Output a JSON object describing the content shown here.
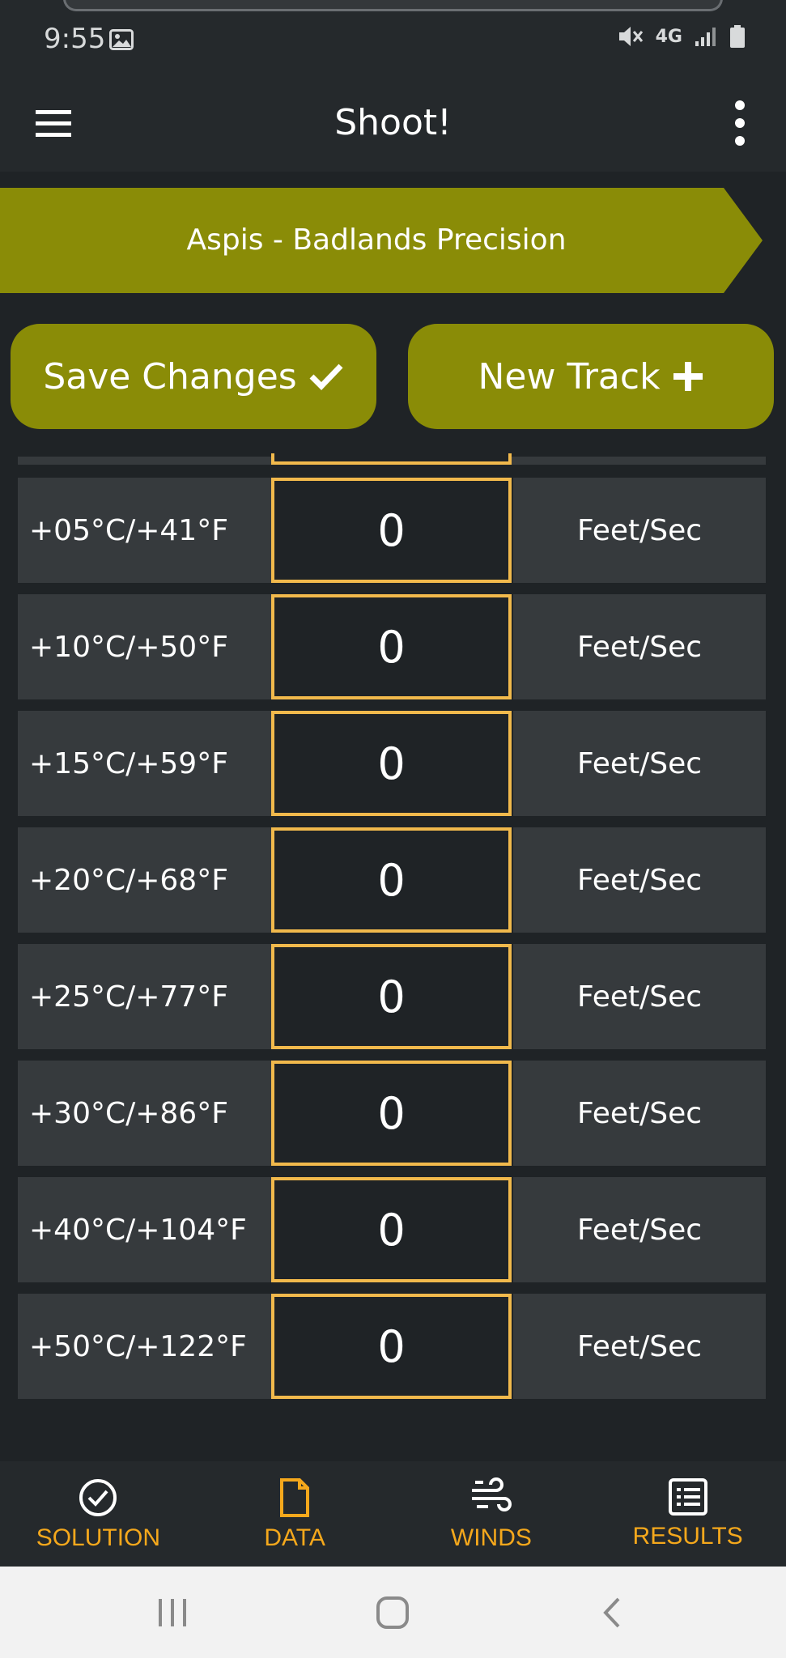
{
  "status": {
    "time": "9:55",
    "network": "4G"
  },
  "app": {
    "title": "Shoot!"
  },
  "track": {
    "name": "Aspis - Badlands Precision"
  },
  "actions": {
    "save_label": "Save Changes",
    "new_label": "New Track"
  },
  "rows": [
    {
      "temp": "+05°C/+41°F",
      "value": "0",
      "unit": "Feet/Sec"
    },
    {
      "temp": "+10°C/+50°F",
      "value": "0",
      "unit": "Feet/Sec"
    },
    {
      "temp": "+15°C/+59°F",
      "value": "0",
      "unit": "Feet/Sec"
    },
    {
      "temp": "+20°C/+68°F",
      "value": "0",
      "unit": "Feet/Sec"
    },
    {
      "temp": "+25°C/+77°F",
      "value": "0",
      "unit": "Feet/Sec"
    },
    {
      "temp": "+30°C/+86°F",
      "value": "0",
      "unit": "Feet/Sec"
    },
    {
      "temp": "+40°C/+104°F",
      "value": "0",
      "unit": "Feet/Sec"
    },
    {
      "temp": "+50°C/+122°F",
      "value": "0",
      "unit": "Feet/Sec"
    }
  ],
  "nav": {
    "items": [
      {
        "label": "SOLUTION",
        "icon": "check-circle-icon"
      },
      {
        "label": "DATA",
        "icon": "document-icon"
      },
      {
        "label": "WINDS",
        "icon": "wind-icon"
      },
      {
        "label": "RESULTS",
        "icon": "list-icon"
      }
    ]
  },
  "colors": {
    "accent": "#8a8c07",
    "highlight": "#f1b94c",
    "nav_label": "#f5a81c",
    "background": "#1f2326",
    "cell": "#363a3d"
  }
}
